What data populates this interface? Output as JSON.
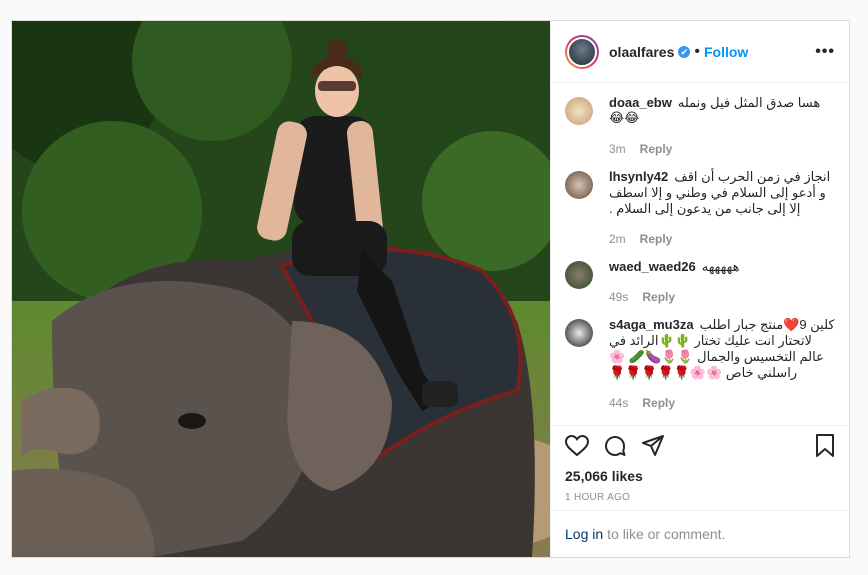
{
  "post": {
    "username": "olaalfares",
    "verified_mark": "✔",
    "separator": "•",
    "follow_label": "Follow",
    "more_label": "•••",
    "image_alt": "Woman in sunglasses sitting on an elephant in a jungle"
  },
  "comments": [
    {
      "user": "doaa_ebw",
      "text": "هسا صدق المثل فيل ونمله",
      "emoji": "😂😂",
      "age": "3m",
      "reply": "Reply"
    },
    {
      "user": "lhsynly42",
      "text": "انجاز في زمن الحرب أن اقف و أدعو إلى السلام في وطني و إلا اسطف إلا إلى جانب من يدعون إلى السلام .",
      "emoji": "",
      "age": "2m",
      "reply": "Reply"
    },
    {
      "user": "waed_waed26",
      "text": "هههههه",
      "emoji": "",
      "age": "49s",
      "reply": "Reply"
    },
    {
      "user": "s4aga_mu3za",
      "text": "كلين 9❤️منتج جبار اطلب لاتحتار انت عليك تختار 🌵🌵الرائد في عالم التخسيس والجمال 🌷🌷🍆🥒 🌸 راسلني خاص 🌸🌸🌹🌹🌹🌹🌹",
      "emoji": "",
      "age": "44s",
      "reply": "Reply"
    }
  ],
  "actions": {
    "likes": "25,066 likes",
    "time": "1 HOUR AGO",
    "login_link": "Log in",
    "login_rest": "to like or comment."
  },
  "icons": [
    "heart-icon",
    "comment-icon",
    "share-icon",
    "bookmark-icon"
  ]
}
